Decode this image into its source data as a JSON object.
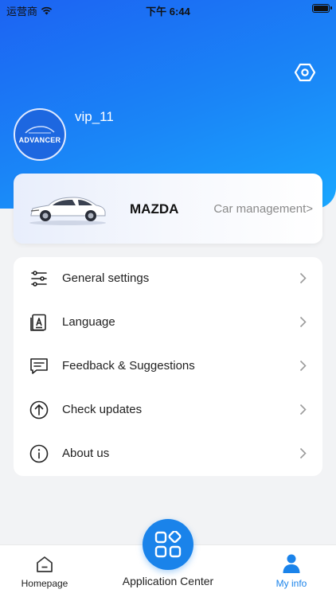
{
  "status_bar": {
    "carrier": "运营商",
    "time": "下午 6:44"
  },
  "profile": {
    "username": "vip_11",
    "avatar_text": "ADVANCER"
  },
  "car": {
    "brand": "MAZDA",
    "manage_label": "Car management>"
  },
  "menu": [
    {
      "label": "General settings",
      "icon": "sliders-icon"
    },
    {
      "label": "Language",
      "icon": "language-icon"
    },
    {
      "label": "Feedback & Suggestions",
      "icon": "feedback-icon"
    },
    {
      "label": "Check updates",
      "icon": "upload-icon"
    },
    {
      "label": "About us",
      "icon": "info-icon"
    }
  ],
  "tabs": {
    "homepage": "Homepage",
    "application_center": "Application Center",
    "my_info": "My info"
  },
  "colors": {
    "accent": "#1a83ea",
    "header_start": "#1c63f2",
    "header_end": "#1aa7ff"
  }
}
